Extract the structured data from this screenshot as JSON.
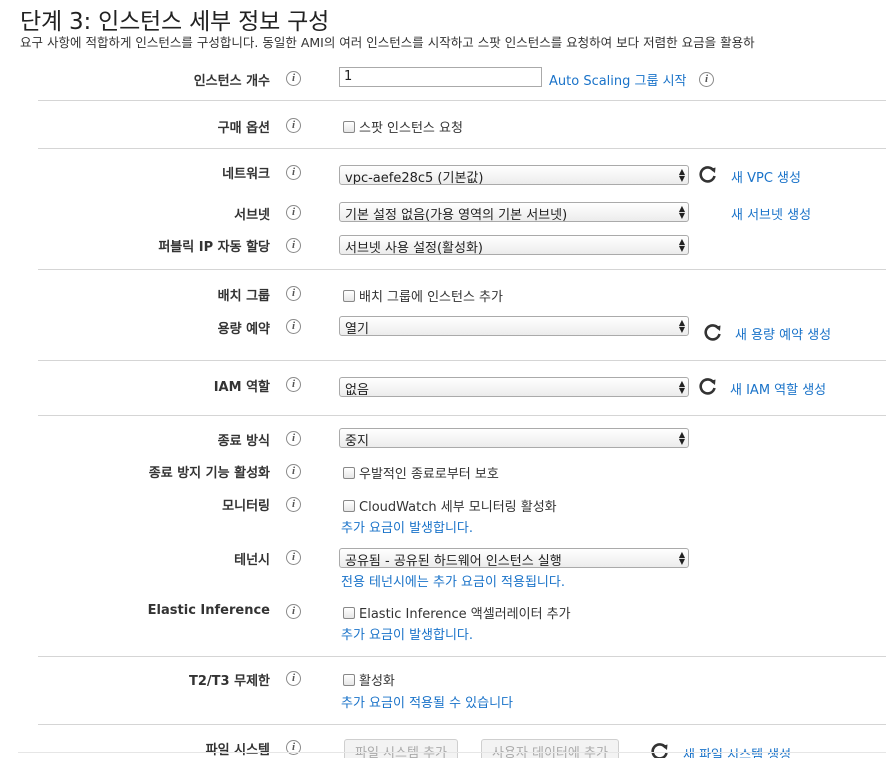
{
  "page": {
    "title": "단계 3: 인스턴스 세부 정보 구성",
    "subtitle": "요구 사항에 적합하게 인스턴스를 구성합니다. 동일한 AMI의 여러 인스턴스를 시작하고 스팟 인스턴스를 요청하여 보다 저렴한 요금을 활용하"
  },
  "fields": {
    "instance_count": {
      "label": "인스턴스 개수",
      "value": "1",
      "link": "Auto Scaling 그룹 시작"
    },
    "purchase_option": {
      "label": "구매 옵션",
      "checkbox": "스팟 인스턴스 요청"
    },
    "network": {
      "label": "네트워크",
      "value": "vpc-aefe28c5 (기본값)",
      "link": "새 VPC 생성"
    },
    "subnet": {
      "label": "서브넷",
      "value": "기본 설정 없음(가용 영역의 기본 서브넷)",
      "link": "새 서브넷 생성"
    },
    "public_ip": {
      "label": "퍼블릭 IP 자동 할당",
      "value": "서브넷 사용 설정(활성화)"
    },
    "placement_group": {
      "label": "배치 그룹",
      "checkbox": "배치 그룹에 인스턴스 추가"
    },
    "capacity_reservation": {
      "label": "용량 예약",
      "value": "열기",
      "link": "새 용량 예약 생성"
    },
    "iam_role": {
      "label": "IAM 역할",
      "value": "없음",
      "link": "새 IAM 역할 생성"
    },
    "shutdown_behavior": {
      "label": "종료 방식",
      "value": "중지"
    },
    "termination_protection": {
      "label": "종료 방지 기능 활성화",
      "checkbox": "우발적인 종료로부터 보호"
    },
    "monitoring": {
      "label": "모니터링",
      "checkbox": "CloudWatch 세부 모니터링 활성화",
      "note": "추가 요금이 발생합니다."
    },
    "tenancy": {
      "label": "테넌시",
      "value": "공유됨 - 공유된 하드웨어 인스턴스 실행",
      "note": "전용 테넌시에는 추가 요금이 적용됩니다."
    },
    "elastic_inference": {
      "label": "Elastic Inference",
      "checkbox": "Elastic Inference 액셀러레이터 추가",
      "note": "추가 요금이 발생합니다."
    },
    "t2t3_unlimited": {
      "label": "T2/T3 무제한",
      "checkbox": "활성화",
      "note": "추가 요금이 적용될 수 있습니다"
    },
    "file_systems": {
      "label": "파일 시스템",
      "add_button": "파일 시스템 추가",
      "user_data_button": "사용자 데이터에 추가",
      "link": "새 파일 시스템 생성"
    }
  },
  "icons": {
    "info": "info-icon",
    "refresh": "refresh-icon",
    "select_arrows": "select-arrows-icon",
    "checkbox": "checkbox-icon"
  },
  "colors": {
    "link": "#1a73c9",
    "divider": "#d5d5d5",
    "label": "#333333"
  }
}
